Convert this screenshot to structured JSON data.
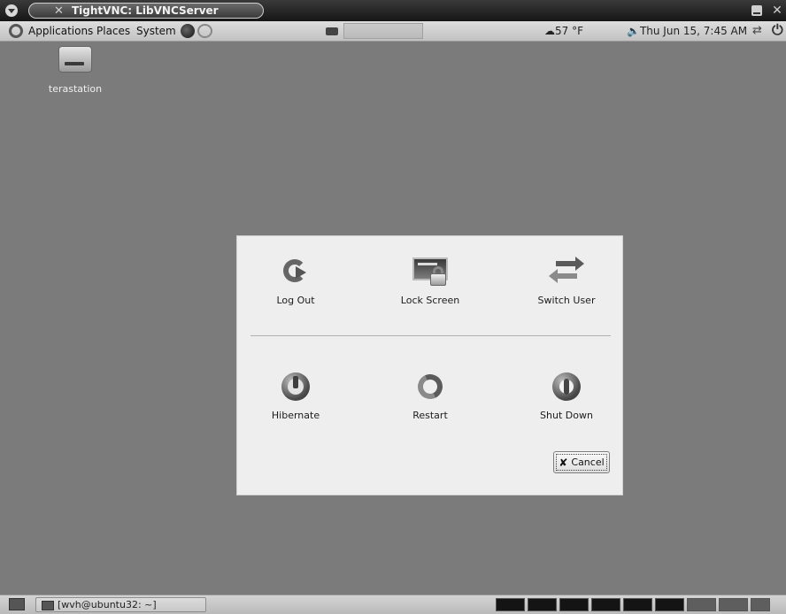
{
  "window": {
    "title": "TightVNC: LibVNCServer"
  },
  "top_panel": {
    "menus": [
      "Applications",
      "Places",
      "System"
    ],
    "weather": "57 °F",
    "clock": "Thu Jun 15,  7:45 AM"
  },
  "desktop": {
    "icons": [
      {
        "label": "terastation"
      }
    ]
  },
  "dialog": {
    "actions": [
      {
        "label": "Log Out"
      },
      {
        "label": "Lock Screen"
      },
      {
        "label": "Switch User"
      },
      {
        "label": "Hibernate"
      },
      {
        "label": "Restart"
      },
      {
        "label": "Shut Down"
      }
    ],
    "cancel_label": "Cancel"
  },
  "bottom_panel": {
    "task_label": "[wvh@ubuntu32: ~]"
  }
}
